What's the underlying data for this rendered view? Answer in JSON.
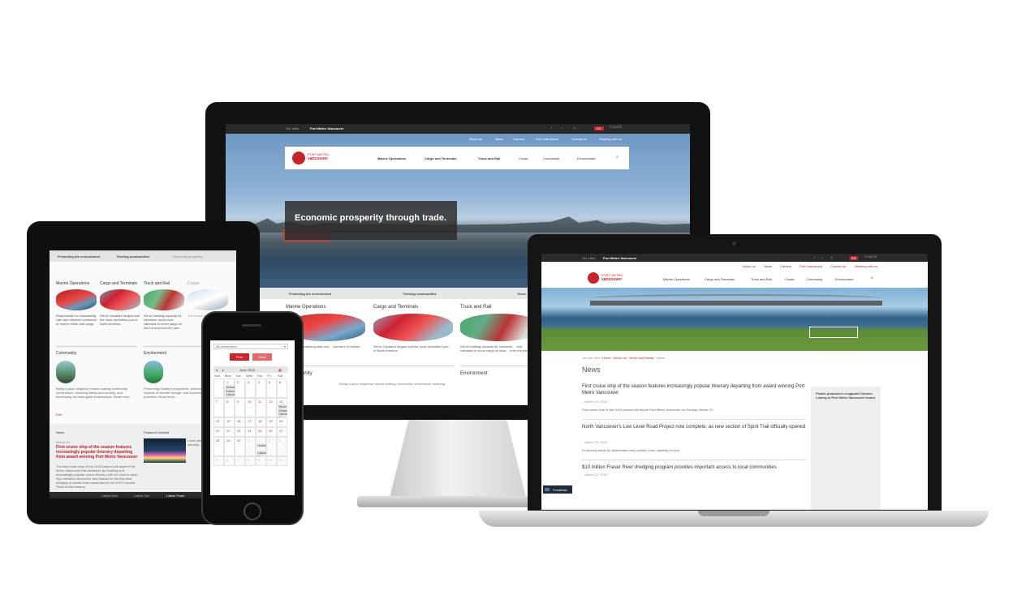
{
  "monitor": {
    "topbar": {
      "our_sites_label": "Our sites:",
      "site_name": "Port Metro Vancouver",
      "lang": "EN",
      "canada": "Canadä"
    },
    "utility_links": [
      "About us",
      "News",
      "Careers",
      "Port Dashboard",
      "Contact us",
      "Working with us"
    ],
    "logo_line1": "PORT METRO",
    "logo_line2": "vancouver",
    "nav": [
      "Marine Operations",
      "Cargo and Terminals",
      "Truck and Rail",
      "Cruise",
      "Community",
      "Environment"
    ],
    "hero_text": "Economic prosperity through trade.",
    "tabs": [
      "Protecting the environment",
      "Thriving communities",
      "Econ"
    ],
    "cards": [
      {
        "title": "Marine Operations",
        "text": "…ble for maintaining safe and …ovement of marine traffic and"
      },
      {
        "title": "Cargo and Terminals",
        "text": "We're Canada's largest and the most diversified port in North America."
      },
      {
        "title": "Truck and Rail",
        "text": "We're building capacity for container… and railroads to move cargo on land… from the port."
      }
    ],
    "lower_titles": [
      "…unity",
      "Environment"
    ],
    "lower_text": "Being a good neighbour means making community connections, ensuring"
  },
  "tablet": {
    "tabs": [
      "Protecting the environment",
      "Thriving communities",
      "Economic prosperity"
    ],
    "cards": [
      {
        "title": "Marine Operations",
        "text": "Responsible for maintaining safe and efficient movement of marine traffic and cargo."
      },
      {
        "title": "Cargo and Terminals",
        "text": "We're Canada's largest and the most diversified port in North America."
      },
      {
        "title": "Truck and Rail",
        "text": "We're building capacity for container trucks and railroads to move cargo on land to and from the port."
      },
      {
        "title": "Cruise",
        "text": "The cruise ship…"
      }
    ],
    "community_title": "Community",
    "community_text": "Being a good neighbor means making community connections, ensuring safety and security, and developing our Aboriginal relationships. Read more...",
    "environment_title": "Environment",
    "environment_text": "Preserving healthy ecosystems, protecting potential impacts of climate change, and improving responsible practices. Read more...",
    "edit_link": "Edit",
    "news_label": "News",
    "featured_label": "Featured Content",
    "news_date": "March 20",
    "news_headline": "First cruise ship of the season features increasingly popular itinerary departing from award winning Port Metro Vancouver",
    "news_body": "The first cruise ship of the 2015 season will depart Port Metro Vancouver this weekend. An exciting and increasingly popular cruise itinerary will run back-to-back trips between Vancouver and Hawaii for the first time, bringing an earlier-than-usual start to the 2015 Canada Place cruise season.",
    "featured_body": "Learn about the shipping industry… Learn more",
    "bottom_tabs": [
      "Latest Now",
      "Latest Two",
      "Latest Three"
    ]
  },
  "phone": {
    "select_value": "All cruise lines",
    "buttons": [
      "Print",
      "Clear"
    ],
    "month": "June 2015",
    "weekdays": [
      "Sun",
      "Mon",
      "Tue",
      "Wed",
      "Thu",
      "Fri",
      "Sat"
    ],
    "weeks": [
      [
        "",
        "1",
        "2",
        "3",
        "4",
        "5",
        "6"
      ],
      [
        "7",
        "8",
        "9",
        "10",
        "11",
        "12",
        "13"
      ],
      [
        "14",
        "15",
        "16",
        "17",
        "18",
        "19",
        "20"
      ],
      [
        "21",
        "22",
        "23",
        "24",
        "25",
        "26",
        "27"
      ],
      [
        "28",
        "29",
        "30",
        "1",
        "2",
        "3",
        "4"
      ],
      [
        "5",
        "6",
        "7",
        "8",
        "9",
        "10",
        "11"
      ]
    ],
    "events": [
      "Grand Princess",
      "Canada Place",
      "Silver Shadow",
      "Canada Place",
      "Oosterdam",
      "Canada Place"
    ]
  },
  "laptop": {
    "topbar": {
      "our_sites_label": "Our sites:",
      "site_name": "Port Metro Vancouver",
      "lang": "EN",
      "canada": "Canadä"
    },
    "utility_links": [
      "About us",
      "News",
      "Careers",
      "Port Dashboard",
      "Contact us",
      "Working with us"
    ],
    "logo_line1": "PORT METRO",
    "logo_line2": "vancouver",
    "nav": [
      "Marine Operations",
      "Cargo and Terminals",
      "Truck and Rail",
      "Cruise",
      "Community",
      "Environment"
    ],
    "breadcrumb": [
      "You are here:",
      "Home",
      "About us",
      "News and Media",
      "News"
    ],
    "heading": "News",
    "items": [
      {
        "title": "First cruise ship of the season features increasingly popular itinerary departing from award winning Port Metro Vancouver",
        "date": "– March 20, 2015",
        "text": "First cruise ship of the 2015 season will depart Port Metro Vancouver on Sunday, March 22."
      },
      {
        "title": "North Vancouver's Low Level Road Project now complete, as new section of Spirit Trail officially opened",
        "date": "– March 20, 2015",
        "text": "Enhanced safety for pedestrians and cyclists; more capacity for port"
      },
      {
        "title": "$10 million Fraser River dredging program provides important access to local communities",
        "date": "– March 12, 2015",
        "text": ""
      }
    ],
    "sidebar_text": "Prairie producers re-appoint Carmen Loberg to Port Metro Vancouver board",
    "feedback_label": "Feedback"
  },
  "colors": {
    "brand_red": "#c8242c",
    "dark_bar": "#2a2a2a"
  }
}
